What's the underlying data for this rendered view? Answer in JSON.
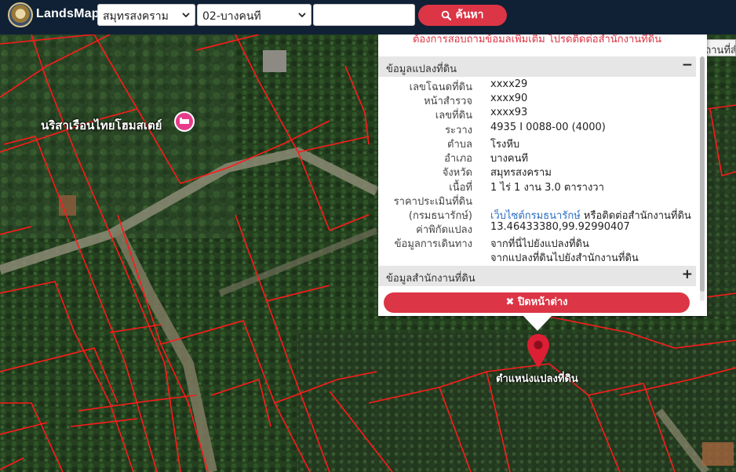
{
  "app": {
    "title": "LandsMaps",
    "province": "สมุทรสงคราม",
    "district": "02-บางคนที",
    "search_value": "",
    "search_button": "ค้นหา"
  },
  "map": {
    "poi_label": "นริสาเรือนไทยโฮมสเตย์",
    "marker_label": "ตำแหน่งแปลงที่ดิน",
    "search_place_tooltip": "ค้นหาสถานที่สำ"
  },
  "popup": {
    "contact_note": "ต้องการสอบถามข้อมูลเพิ่มเติม โปรดติดต่อสำนักงานที่ดิน",
    "parcel_header": "ข้อมูลแปลงที่ดิน",
    "parcel_toggle": "−",
    "rows": [
      {
        "k": "เลขโฉนดที่ดิน",
        "v": "xxxx29"
      },
      {
        "k": "หน้าสำรวจ",
        "v": "xxxx90"
      },
      {
        "k": "เลขที่ดิน",
        "v": "xxxx93"
      },
      {
        "k": "ระวาง",
        "v": "4935 I 0088-00 (4000)"
      },
      {
        "k": "ตำบล",
        "v": "โรงหีบ"
      },
      {
        "k": "อำเภอ",
        "v": "บางคนที"
      },
      {
        "k": "จังหวัด",
        "v": "สมุทรสงคราม"
      },
      {
        "k": "เนื้อที่",
        "v": "1 ไร่ 1 งาน 3.0 ตารางวา"
      }
    ],
    "price_label_1": "ราคาประเมินที่ดิน",
    "price_label_2": "(กรมธนารักษ์)",
    "price_link": "เว็บไซต์กรมธนารักษ์",
    "price_rest": " หรือติดต่อสำนักงานที่ดิน",
    "coord_label": "ค่าพิกัดแปลง",
    "coord_value": "13.46433380,99.92990407",
    "travel_label": "ข้อมูลการเดินทาง",
    "travel_link_1": "จากที่นี่ไปยังแปลงที่ดิน",
    "travel_link_2": "จากแปลงที่ดินไปยังสำนักงานที่ดิน",
    "office_header": "ข้อมูลสำนักงานที่ดิน",
    "office_toggle": "+",
    "close_button": "ปิดหน้าต่าง"
  },
  "colors": {
    "topbar": "#102135",
    "accent": "#dc3545",
    "link": "#2a6fc2",
    "parcel_line": "#ff1a1a"
  },
  "icons": [
    "logo-emblem",
    "caret-down-icon",
    "search-icon",
    "homestay-pin-icon",
    "location-marker-icon",
    "close-x-icon"
  ]
}
